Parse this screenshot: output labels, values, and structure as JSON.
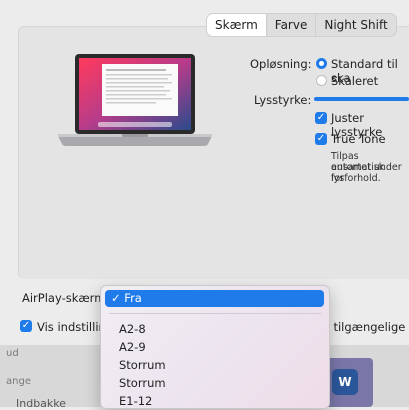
{
  "tabs": [
    {
      "label": "Skærm",
      "active": true
    },
    {
      "label": "Farve",
      "active": false
    },
    {
      "label": "Night Shift",
      "active": false
    }
  ],
  "resolution": {
    "label": "Opløsning:",
    "options": [
      {
        "label": "Standard til ska",
        "selected": true
      },
      {
        "label": "Skaleret",
        "selected": false
      }
    ]
  },
  "brightness": {
    "label": "Lysstyrke:",
    "auto_label": "Juster lysstyrke",
    "auto_checked": true
  },
  "true_tone": {
    "label": "True Tone",
    "checked": true,
    "description": [
      "Tilpas automatisk",
      "ensartet under for",
      "lysforhold."
    ]
  },
  "airplay": {
    "label": "AirPlay-skærm:",
    "menu": {
      "selected": "✓ Fra",
      "items": [
        "A2-8",
        "A2-9",
        "Storrum",
        "Storrum",
        "E1-12"
      ]
    }
  },
  "show_mirroring": {
    "label": "Vis indstilling",
    "trailing": "er tilgængelige",
    "checked": true
  },
  "background": {
    "texts": [
      "ud",
      "ange",
      "Indbakke"
    ],
    "dock_icon": "W"
  },
  "colors": {
    "accent": "#1f7bea",
    "word": "#2b579a"
  }
}
